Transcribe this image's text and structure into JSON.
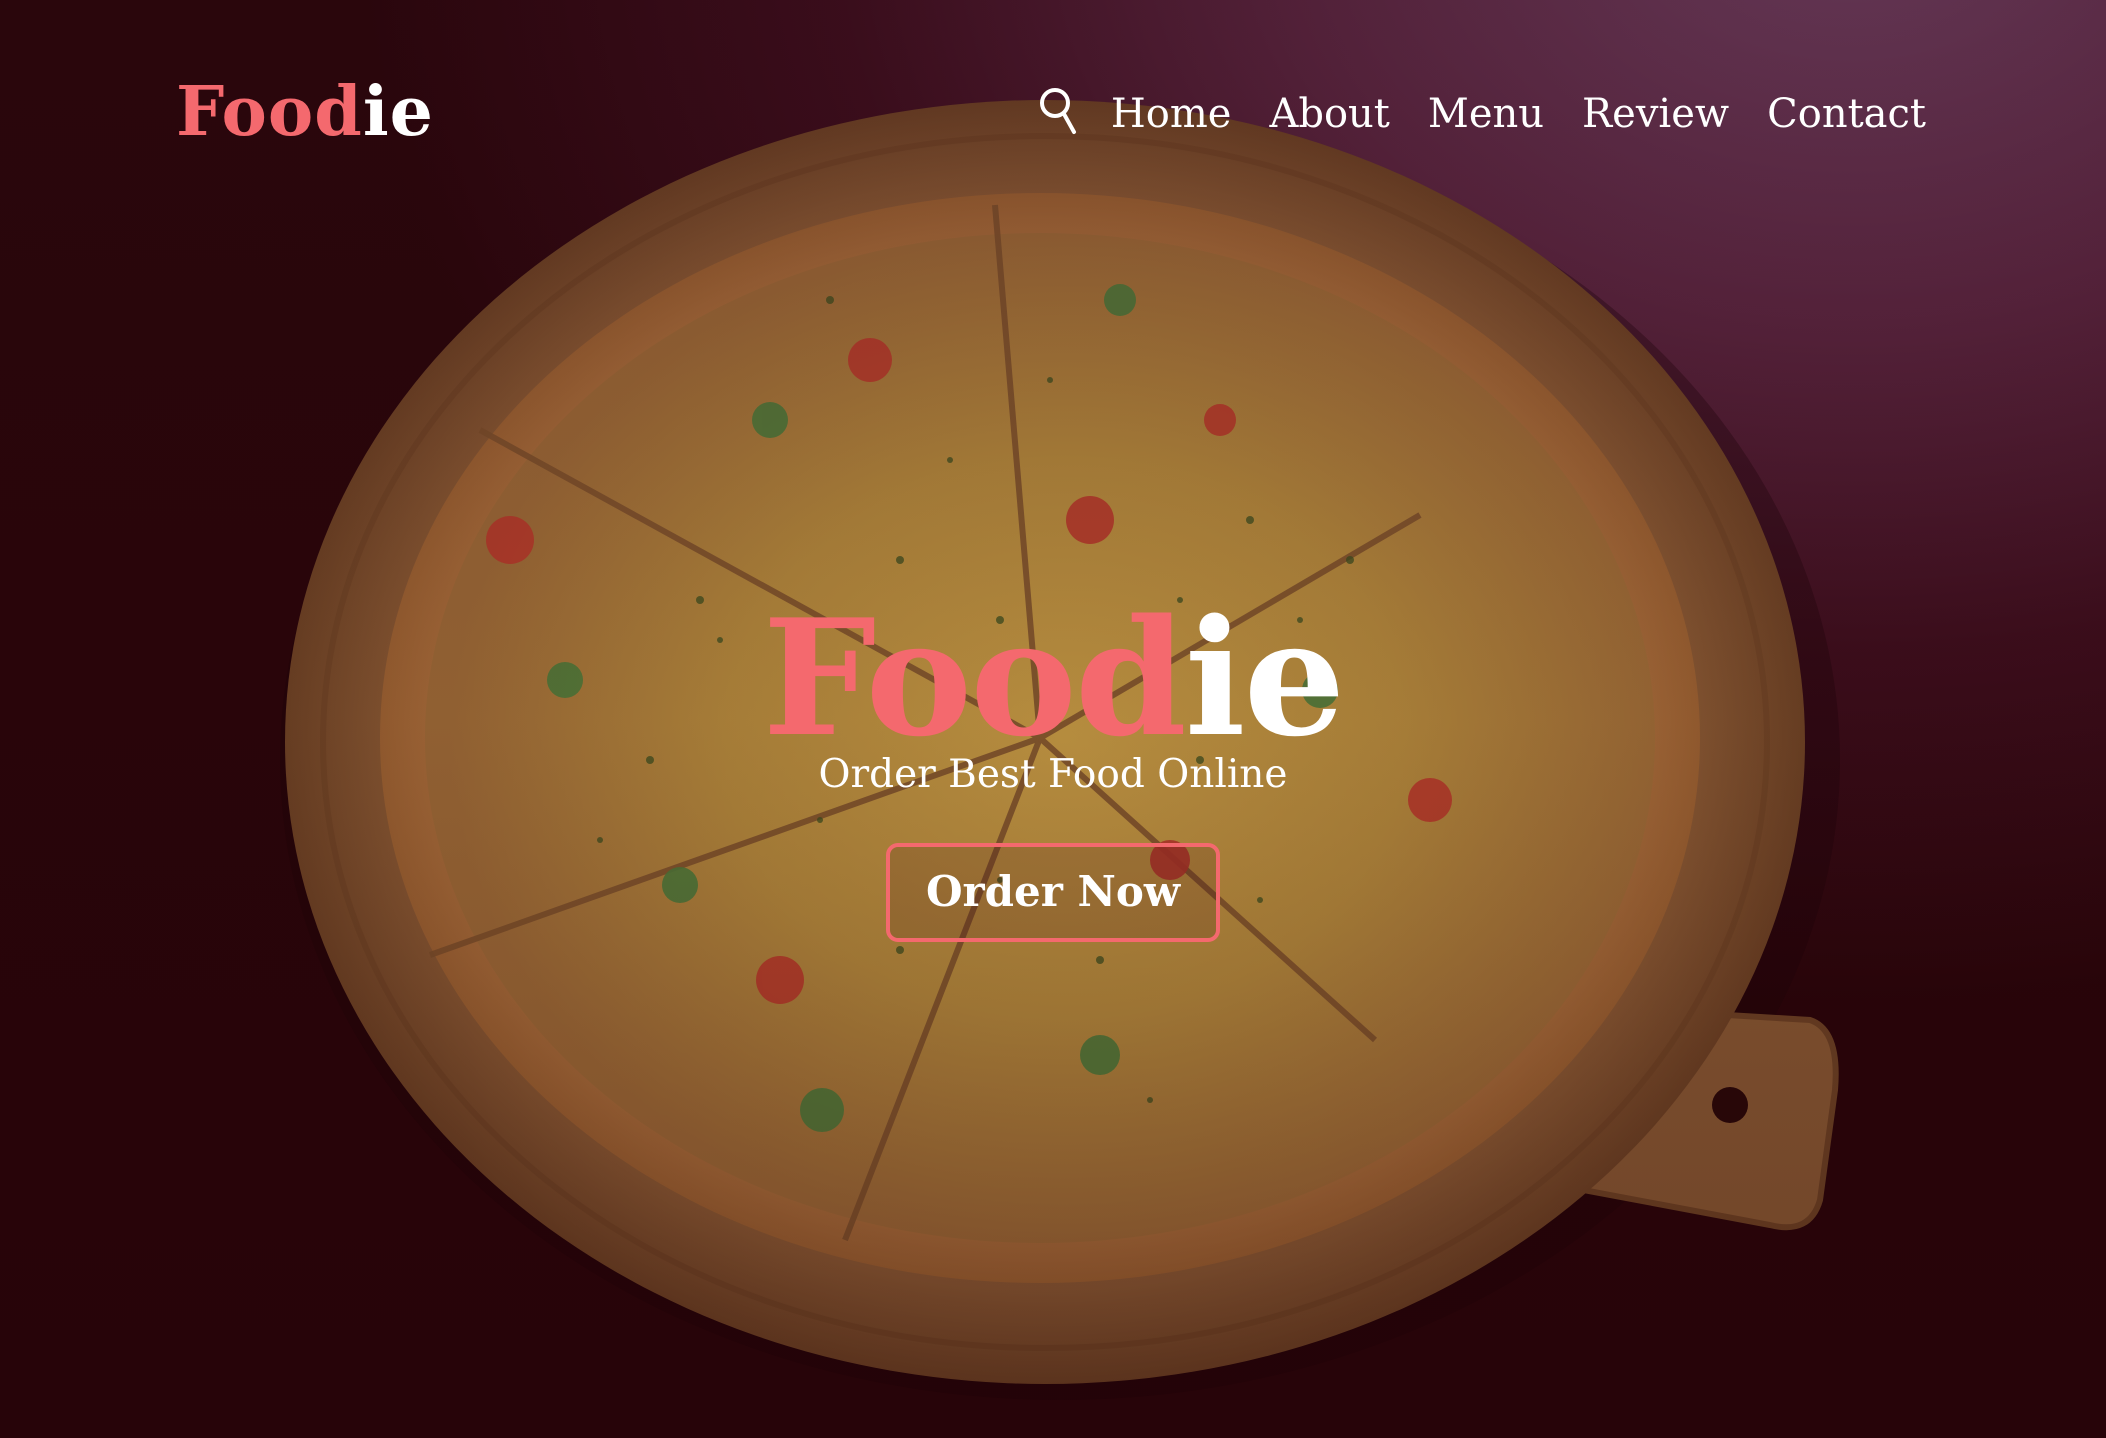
{
  "brand": {
    "part1": "Food",
    "part2": "ie"
  },
  "nav": {
    "items": [
      {
        "label": "Home"
      },
      {
        "label": "About"
      },
      {
        "label": "Menu"
      },
      {
        "label": "Review"
      },
      {
        "label": "Contact"
      }
    ],
    "search_icon": "search-icon"
  },
  "hero": {
    "title_part1": "Food",
    "title_part2": "ie",
    "tagline": "Order Best Food Online",
    "cta_label": "Order Now"
  },
  "colors": {
    "accent": "#f4696e",
    "text": "#ffffff",
    "background": "#5c2640"
  }
}
